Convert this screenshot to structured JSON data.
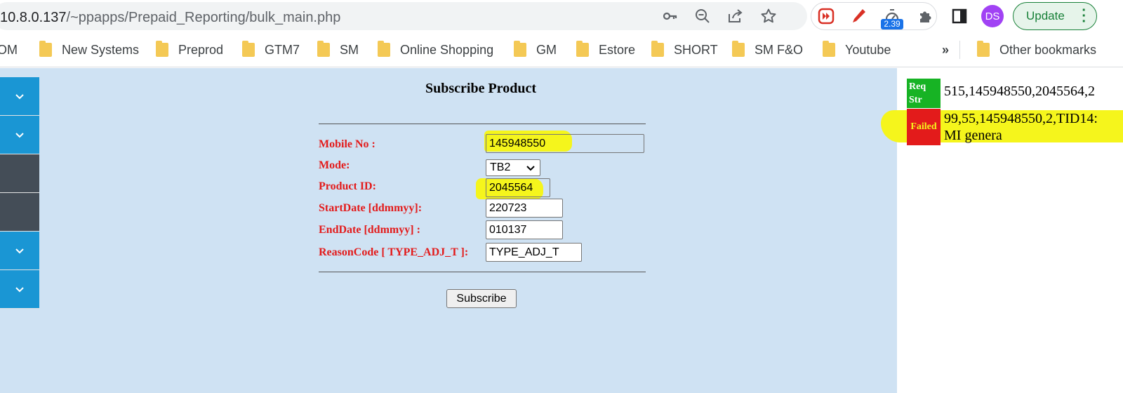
{
  "browser": {
    "url_host": "10.8.0.137",
    "url_path": "/~ppapps/Prepaid_Reporting/bulk_main.php",
    "toolbar_icons": [
      "key-icon",
      "zoom-out-icon",
      "share-icon",
      "star-icon"
    ],
    "extension_badge": "2.39",
    "profile_initials": "DS",
    "update_label": "Update"
  },
  "bookmarks": {
    "items": [
      "OM",
      "New Systems",
      "Preprod",
      "GTM7",
      "SM",
      "Online Shopping",
      "GM",
      "Estore",
      "SHORT",
      "SM F&O",
      "Youtube"
    ],
    "overflow": "»",
    "other": "Other bookmarks"
  },
  "form": {
    "title": "Subscribe Product",
    "labels": {
      "mobile": "Mobile No :",
      "mode": "Mode:",
      "product": "Product ID:",
      "start": "StartDate [ddmmyy]:",
      "end": "EndDate [ddmmyy] :",
      "reason": "ReasonCode [ TYPE_ADJ_T ]:"
    },
    "values": {
      "mobile": "145948550",
      "mode": "TB2",
      "product": "2045564",
      "start": "220723",
      "end": "010137",
      "reason": "TYPE_ADJ_T"
    },
    "submit_label": "Subscribe"
  },
  "result": {
    "req_label": "Req Str",
    "req_value": "515,145948550,2045564,2",
    "status_label": "Failed",
    "status_line1": "99,55,145948550,2,TID14:",
    "status_line2": "MI genera"
  },
  "colors": {
    "label_red": "#e31b1b",
    "panel_bg": "#cfe2f3",
    "highlight": "#f5f51c",
    "req_green": "#17b324",
    "sidebar_blue": "#1a96d4",
    "sidebar_dark": "#444d57"
  }
}
